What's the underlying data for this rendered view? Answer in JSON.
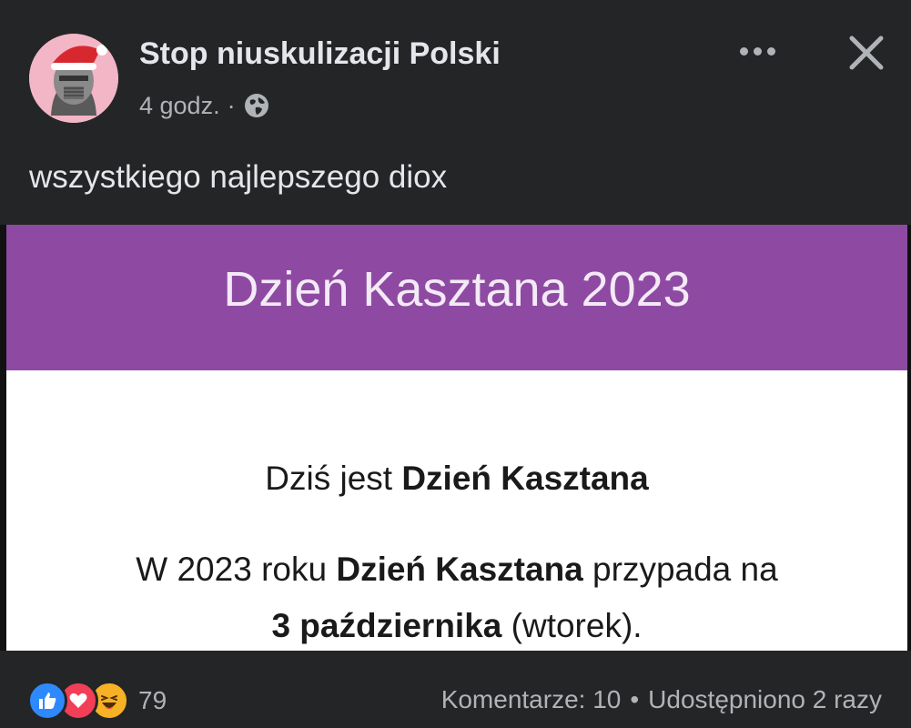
{
  "post": {
    "page_name": "Stop niuskulizacji Polski",
    "time": "4 godz.",
    "separator": "·",
    "privacy_icon": "globe-icon",
    "caption": "wszystkiego najlepszego diox"
  },
  "image": {
    "banner_title": "Dzień Kasztana 2023",
    "line1_prefix": "Dziś jest ",
    "line1_bold": "Dzień Kasztana",
    "line2_prefix": "W 2023 roku ",
    "line2_bold": "Dzień Kasztana",
    "line2_suffix": " przypada na",
    "line3_bold": "3 października",
    "line3_suffix": " (wtorek).",
    "banner_color": "#8e4aa2"
  },
  "footer": {
    "reaction_icons": [
      "like-icon",
      "love-icon",
      "haha-icon"
    ],
    "reaction_count": "79",
    "comments": "Komentarze: 10",
    "bullet": "•",
    "shares": "Udostępniono 2 razy"
  },
  "colors": {
    "background": "#242526",
    "text_primary": "#e4e6eb",
    "text_secondary": "#b0b3b8",
    "like": "#2e89ff",
    "love": "#f33e58",
    "haha": "#f7b125"
  }
}
